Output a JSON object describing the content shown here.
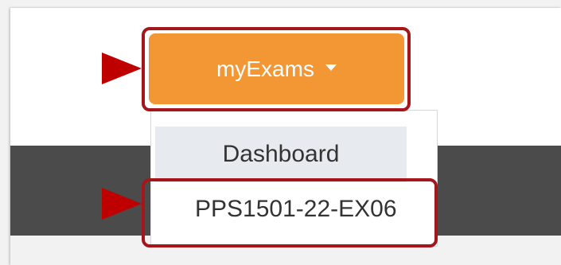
{
  "button": {
    "label": "myExams",
    "icon": "caret-down-icon",
    "color": "#f39634"
  },
  "menu": {
    "items": [
      {
        "label": "Dashboard"
      },
      {
        "label": "PPS1501-22-EX06"
      }
    ]
  },
  "annotation": {
    "highlight_color": "#a5161b",
    "arrow_color": "#bf0000"
  }
}
